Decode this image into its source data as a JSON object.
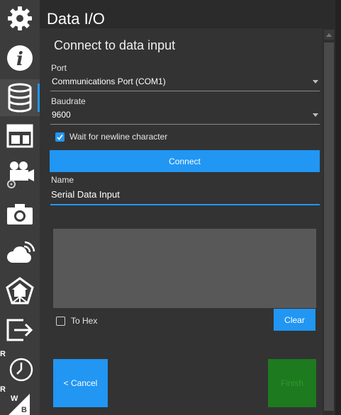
{
  "title": "Data I/O",
  "subtitle": "Connect to data input",
  "sidebar": {
    "items": [
      {
        "icon": "gear-icon"
      },
      {
        "icon": "info-icon"
      },
      {
        "icon": "database-icon",
        "active": true
      },
      {
        "icon": "layout-icon"
      },
      {
        "icon": "video-camera-settings-icon"
      },
      {
        "icon": "camera-icon"
      },
      {
        "icon": "cloud-signal-icon"
      },
      {
        "icon": "network-home-icon"
      },
      {
        "icon": "export-icon"
      },
      {
        "icon": "clock-icon",
        "badge": "R"
      },
      {
        "icon": "white-balance-icon",
        "badge": "R",
        "glyph_top": "W",
        "glyph_bottom": "B"
      }
    ]
  },
  "port": {
    "label": "Port",
    "value": "Communications Port (COM1)"
  },
  "baudrate": {
    "label": "Baudrate",
    "value": "9600"
  },
  "newline": {
    "label": "Wait for newline character",
    "checked": true
  },
  "connect_label": "Connect",
  "name": {
    "label": "Name",
    "value": "Serial Data Input"
  },
  "to_hex": {
    "label": "To Hex",
    "checked": false
  },
  "clear_label": "Clear",
  "cancel_label": "< Cancel",
  "finish_label": "Finish",
  "colors": {
    "accent": "#2196f3",
    "finish": "#1e7a1e",
    "panel": "#333333",
    "sidebar": "#3c3c3c"
  }
}
